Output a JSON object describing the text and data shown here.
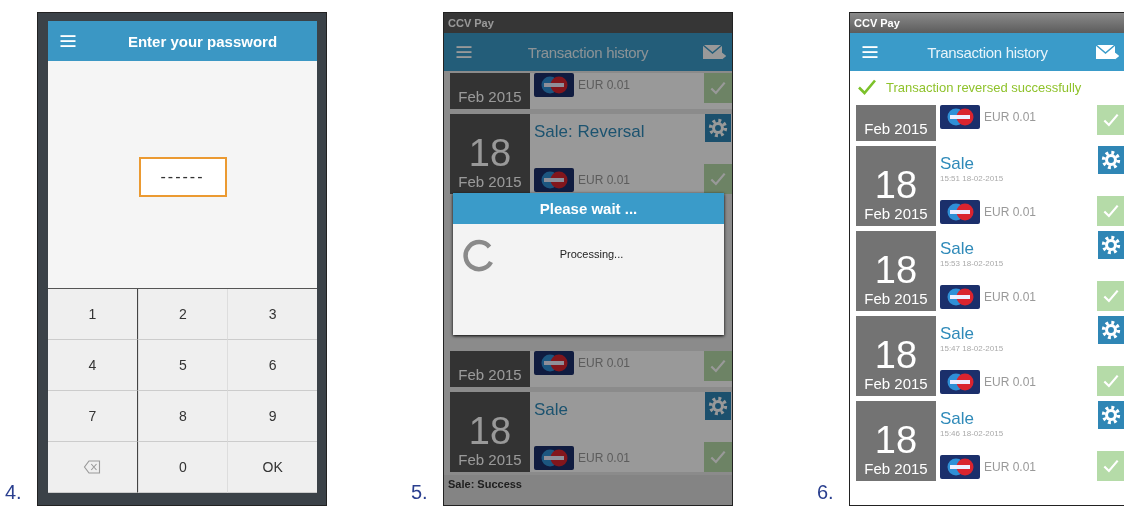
{
  "figures": [
    {
      "number": "4.",
      "screen": {
        "kind": "password",
        "title": "Enter your password",
        "field": {
          "value": "------"
        },
        "keys": [
          {
            "kind": "digit",
            "label": "1"
          },
          {
            "kind": "digit",
            "label": "2"
          },
          {
            "kind": "digit",
            "label": "3"
          },
          {
            "kind": "digit",
            "label": "4"
          },
          {
            "kind": "digit",
            "label": "5"
          },
          {
            "kind": "digit",
            "label": "6"
          },
          {
            "kind": "digit",
            "label": "7"
          },
          {
            "kind": "digit",
            "label": "8"
          },
          {
            "kind": "digit",
            "label": "9"
          },
          {
            "kind": "backspace"
          },
          {
            "kind": "digit",
            "label": "0"
          },
          {
            "kind": "digit",
            "label": "OK"
          }
        ]
      }
    },
    {
      "number": "5.",
      "screen": {
        "kind": "history",
        "dimmed": true,
        "status": "CCV Pay",
        "title": "Transaction history",
        "rows_above": [
          {
            "kind": "tail",
            "month": "Feb 2015",
            "amount": "EUR 0.01"
          },
          {
            "kind": "full",
            "day": "18",
            "month": "Feb 2015",
            "title": "Sale: Reversal",
            "amount": "EUR 0.01"
          }
        ],
        "dialog": {
          "title": "Please wait ...",
          "message": "Processing..."
        },
        "rows_below": [
          {
            "kind": "tail",
            "month": "Feb 2015",
            "amount": "EUR 0.01"
          },
          {
            "kind": "full",
            "day": "18",
            "month": "Feb 2015",
            "title": "Sale",
            "amount": "EUR 0.01"
          }
        ],
        "toast": {
          "title": "Sale: Success"
        }
      }
    },
    {
      "number": "6.",
      "screen": {
        "kind": "history",
        "dimmed": false,
        "status": "CCV Pay",
        "title": "Transaction history",
        "banner": "Transaction reversed successfully",
        "rows_above": [
          {
            "kind": "tail",
            "month": "Feb 2015",
            "amount": "EUR 0.01"
          },
          {
            "kind": "full",
            "day": "18",
            "month": "Feb 2015",
            "title": "Sale",
            "time": "15:51 18-02-2015",
            "amount": "EUR 0.01"
          },
          {
            "kind": "full",
            "day": "18",
            "month": "Feb 2015",
            "title": "Sale",
            "time": "15:53 18-02-2015",
            "amount": "EUR 0.01"
          },
          {
            "kind": "full",
            "day": "18",
            "month": "Feb 2015",
            "title": "Sale",
            "time": "15:47 18-02-2015",
            "amount": "EUR 0.01"
          },
          {
            "kind": "full",
            "day": "18",
            "month": "Feb 2015",
            "title": "Sale",
            "time": "15:46 18-02-2015",
            "amount": "EUR 0.01"
          }
        ]
      }
    }
  ]
}
